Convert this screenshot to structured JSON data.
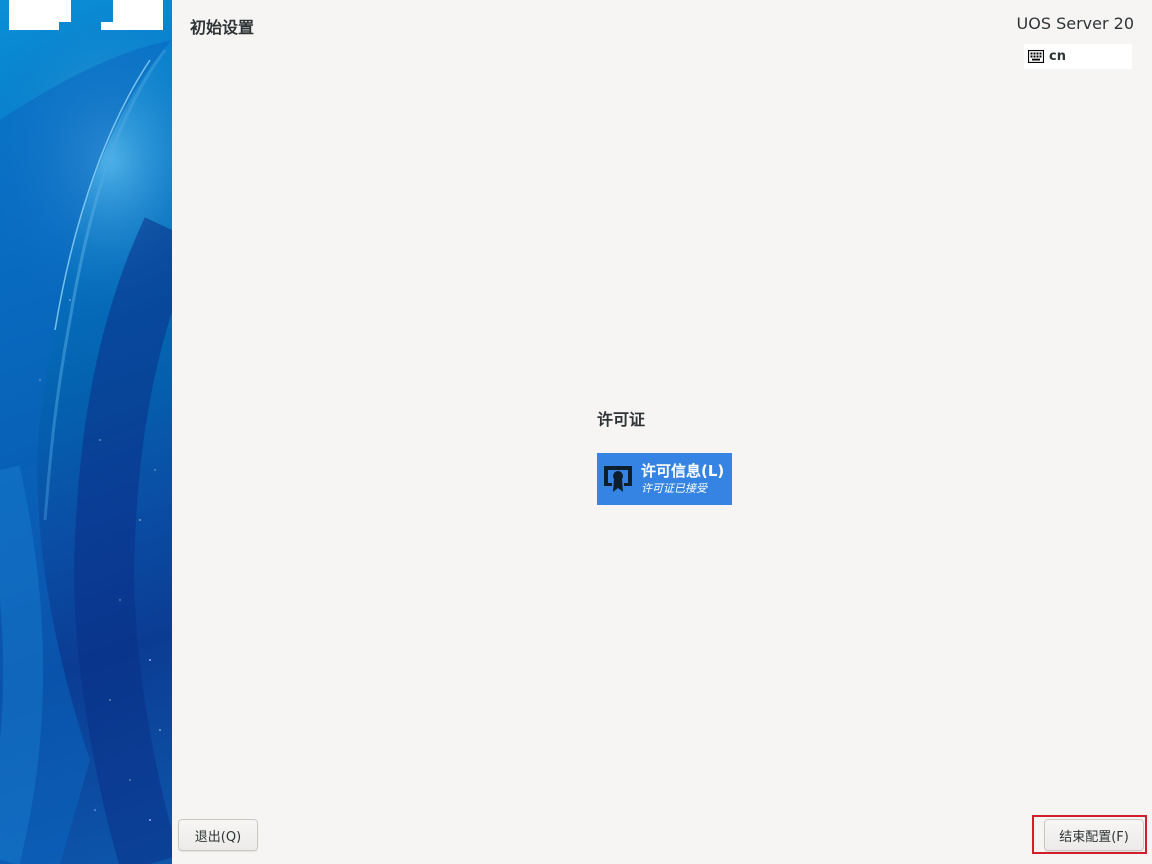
{
  "header": {
    "page_title": "初始设置",
    "product_name": "UOS Server 20",
    "keyboard_layout": "cn"
  },
  "sidebar": {
    "accent_color": "#0a6cc4"
  },
  "main": {
    "section_heading": "许可证",
    "license_spoke": {
      "icon": "license-certificate-icon",
      "title": "许可信息(L)",
      "status": "许可证已接受",
      "color": "#3584e4"
    }
  },
  "footer": {
    "quit_label": "退出(Q)",
    "finish_label": "结束配置(F)",
    "highlight_color": "#d0202a"
  }
}
